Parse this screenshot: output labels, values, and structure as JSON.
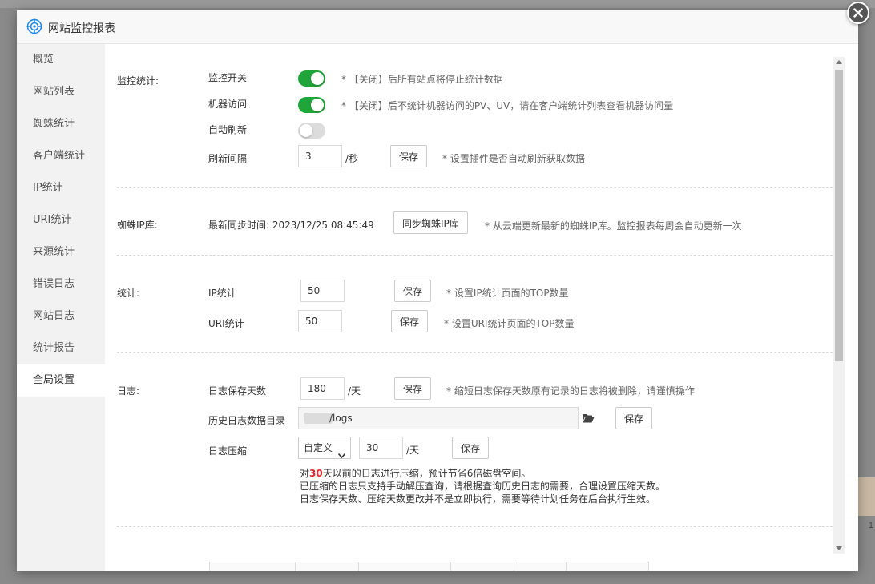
{
  "modal": {
    "title": "网站监控报表"
  },
  "sidebar": {
    "items": [
      {
        "label": "概览"
      },
      {
        "label": "网站列表"
      },
      {
        "label": "蜘蛛统计"
      },
      {
        "label": "客户端统计"
      },
      {
        "label": "IP统计"
      },
      {
        "label": "URI统计"
      },
      {
        "label": "来源统计"
      },
      {
        "label": "错误日志"
      },
      {
        "label": "网站日志"
      },
      {
        "label": "统计报告"
      },
      {
        "label": "全局设置"
      }
    ],
    "active_index": 10
  },
  "monitor": {
    "section_label": "监控统计:",
    "switch_label": "监控开关",
    "switch_on": true,
    "switch_hint": "* 【关闭】后所有站点将停止统计数据",
    "robot_label": "机器访问",
    "robot_on": true,
    "robot_hint": "* 【关闭】后不统计机器访问的PV、UV，请在客户端统计列表查看机器访问量",
    "refresh_label": "自动刷新",
    "refresh_on": false,
    "interval_label": "刷新间隔",
    "interval_value": "3",
    "interval_unit": "/秒",
    "interval_save": "保存",
    "interval_hint": "* 设置插件是否自动刷新获取数据"
  },
  "spider_ip": {
    "section_label": "蜘蛛IP库:",
    "sync_time": "最新同步时间: 2023/12/25 08:45:49",
    "sync_button": "同步蜘蛛IP库",
    "hint": "* 从云端更新最新的蜘蛛IP库。监控报表每周会自动更新一次"
  },
  "stats": {
    "section_label": "统计:",
    "ip_label": "IP统计",
    "ip_value": "50",
    "ip_save": "保存",
    "ip_hint": "* 设置IP统计页面的TOP数量",
    "uri_label": "URI统计",
    "uri_value": "50",
    "uri_save": "保存",
    "uri_hint": "* 设置URI统计页面的TOP数量"
  },
  "logs": {
    "section_label": "日志:",
    "retention_label": "日志保存天数",
    "retention_value": "180",
    "retention_unit": "/天",
    "retention_save": "保存",
    "retention_hint": "* 缩短日志保存天数原有记录的日志将被删除，请谨慎操作",
    "history_label": "历史日志数据目录",
    "history_path": "/logs",
    "history_save": "保存",
    "compress_label": "日志压缩",
    "compress_mode": "自定义",
    "compress_days": "30",
    "compress_unit": "/天",
    "compress_save": "保存",
    "note_prefix": "对",
    "note_days": "30",
    "note_suffix": "天以前的日志进行压缩，预计节省6倍磁盘空间。",
    "note_line2": "已压缩的日志只支持手动解压查询，请根据查询历史日志的需要，合理设置压缩天数。",
    "note_line3": "日志保存天数、压缩天数更改并不是立即执行，需要等待计划任务在后台执行生效。"
  },
  "background": {
    "partial_label": "1"
  },
  "colors": {
    "accent_green": "#20a53a",
    "warning_red": "#e02a2a",
    "sidebar_bg": "#f2f2f2"
  },
  "icons": {
    "logo": "radar-target-icon",
    "close": "close-icon",
    "folder": "folder-open-icon",
    "select": "chevron-down-icon"
  }
}
